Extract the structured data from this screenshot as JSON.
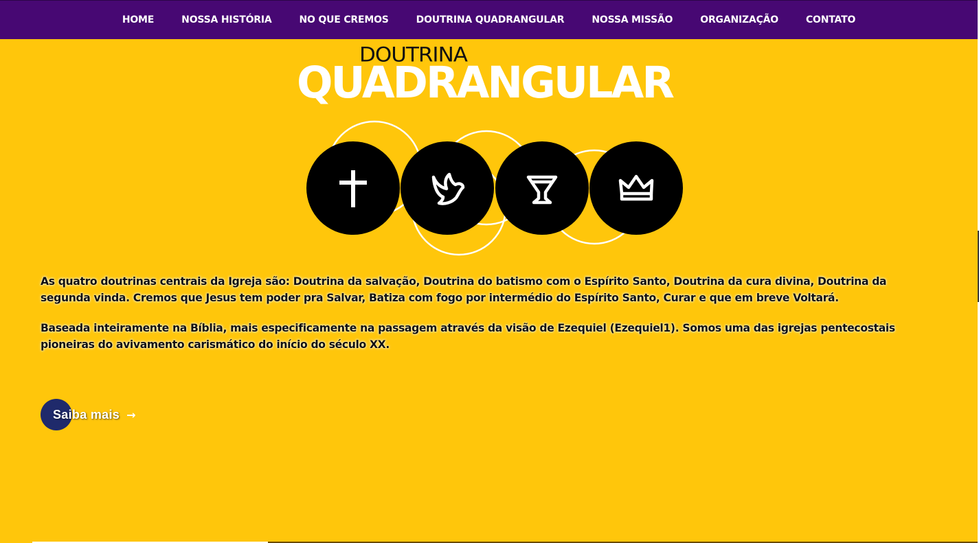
{
  "nav": {
    "items": [
      {
        "label": "HOME"
      },
      {
        "label": "NOSSA HISTÓRIA"
      },
      {
        "label": "NO QUE CREMOS"
      },
      {
        "label": "DOUTRINA QUADRANGULAR"
      },
      {
        "label": "NOSSA MISSÃO"
      },
      {
        "label": "ORGANIZAÇÃO"
      },
      {
        "label": "CONTATO"
      }
    ]
  },
  "hero": {
    "logo_small": "DOUTRINA",
    "logo_big": "QUADRANGULAR",
    "emblem_icons": [
      "cross-icon",
      "dove-icon",
      "cup-icon",
      "crown-icon"
    ]
  },
  "content": {
    "paragraph1": "As quatro doutrinas centrais da Igreja são: Doutrina da salvação, Doutrina do batismo com o Espírito Santo, Doutrina da cura divina, Doutrina da segunda vinda. Cremos que Jesus tem poder pra Salvar, Batiza com fogo por intermédio do Espírito Santo, Curar e que em breve Voltará.",
    "paragraph2": "Baseada inteiramente na Bíblia, mais especificamente na passagem através da visão de Ezequiel (Ezequiel1). Somos uma das igrejas pentecostais pioneiras do avivamento carismático do início do século XX."
  },
  "cta": {
    "label": "Saiba mais",
    "arrow": "→"
  },
  "colors": {
    "background": "#ffc60b",
    "nav": "#470873",
    "cta_circle": "#1f2a6b",
    "emblem_circle": "#000000"
  }
}
